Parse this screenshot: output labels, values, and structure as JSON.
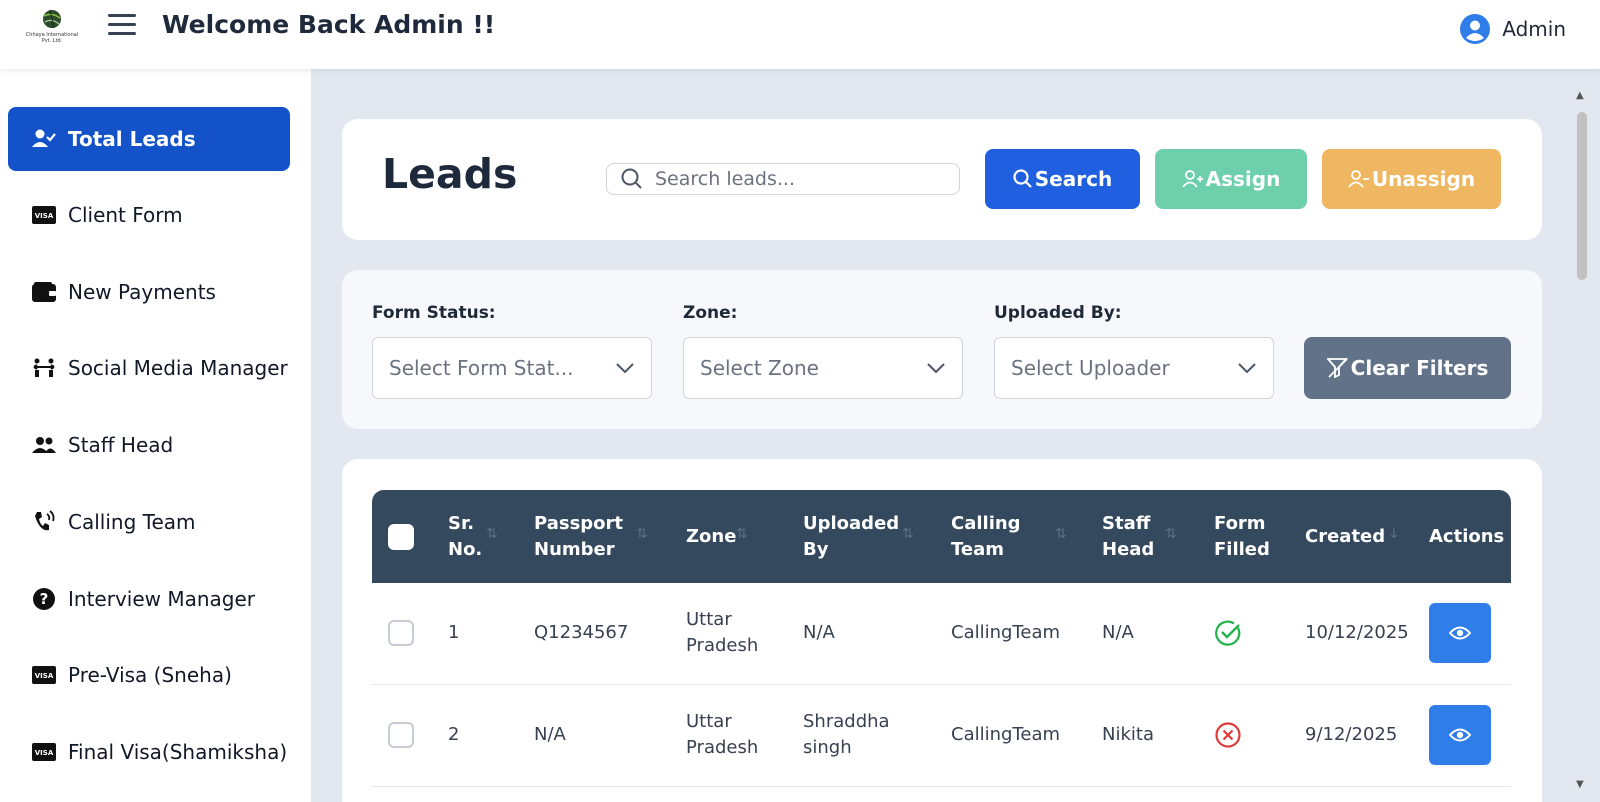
{
  "header": {
    "logo_text": "Chhaya International Pvt. Ltd.",
    "welcome": "Welcome Back Admin !!",
    "user_name": "Admin"
  },
  "sidebar": {
    "items": [
      {
        "label": "Total Leads",
        "icon": "user-check-icon",
        "active": true
      },
      {
        "label": "Client Form",
        "icon": "visa-card-icon"
      },
      {
        "label": "New Payments",
        "icon": "wallet-icon"
      },
      {
        "label": "Social Media Manager",
        "icon": "people-arrows-icon"
      },
      {
        "label": "Staff Head",
        "icon": "users-icon"
      },
      {
        "label": "Calling Team",
        "icon": "phone-volume-icon"
      },
      {
        "label": "Interview Manager",
        "icon": "question-circle-icon"
      },
      {
        "label": "Pre-Visa (Sneha)",
        "icon": "visa-card-icon"
      },
      {
        "label": "Final Visa(Shamiksha)",
        "icon": "visa-card-icon"
      }
    ]
  },
  "leads": {
    "title": "Leads",
    "search_placeholder": "Search leads...",
    "search_label": "Search",
    "assign_label": "Assign",
    "unassign_label": "Unassign"
  },
  "filters": {
    "form_status_label": "Form Status:",
    "form_status_value": "Select Form Stat...",
    "zone_label": "Zone:",
    "zone_value": "Select Zone",
    "uploaded_by_label": "Uploaded By:",
    "uploaded_by_value": "Select Uploader",
    "clear_label": "Clear Filters"
  },
  "table": {
    "columns": {
      "sr_no": [
        "Sr.",
        "No."
      ],
      "passport": [
        "Passport",
        "Number"
      ],
      "zone": "Zone",
      "uploaded_by": [
        "Uploaded",
        "By"
      ],
      "calling_team": [
        "Calling",
        "Team"
      ],
      "staff_head": [
        "Staff",
        "Head"
      ],
      "form_filled": [
        "Form",
        "Filled"
      ],
      "created": "Created",
      "actions": "Actions"
    },
    "rows": [
      {
        "sr": "1",
        "passport": "Q1234567",
        "zone": [
          "Uttar",
          "Pradesh"
        ],
        "uploaded_by": [
          "N/A",
          ""
        ],
        "calling_team": "CallingTeam",
        "staff_head": "N/A",
        "form_filled": true,
        "created": "10/12/2025"
      },
      {
        "sr": "2",
        "passport": "N/A",
        "zone": [
          "Uttar",
          "Pradesh"
        ],
        "uploaded_by": [
          "Shraddha",
          "singh"
        ],
        "calling_team": "CallingTeam",
        "staff_head": "Nikita",
        "form_filled": false,
        "created": "9/12/2025"
      }
    ]
  },
  "colors": {
    "primary": "#1352c9",
    "search_btn": "#1f5fe0",
    "assign_btn": "#6ecfab",
    "unassign_btn": "#f0b763",
    "clear_btn": "#627289",
    "table_header": "#34495e",
    "check_green": "#22b14c",
    "cross_red": "#e03b3b"
  }
}
